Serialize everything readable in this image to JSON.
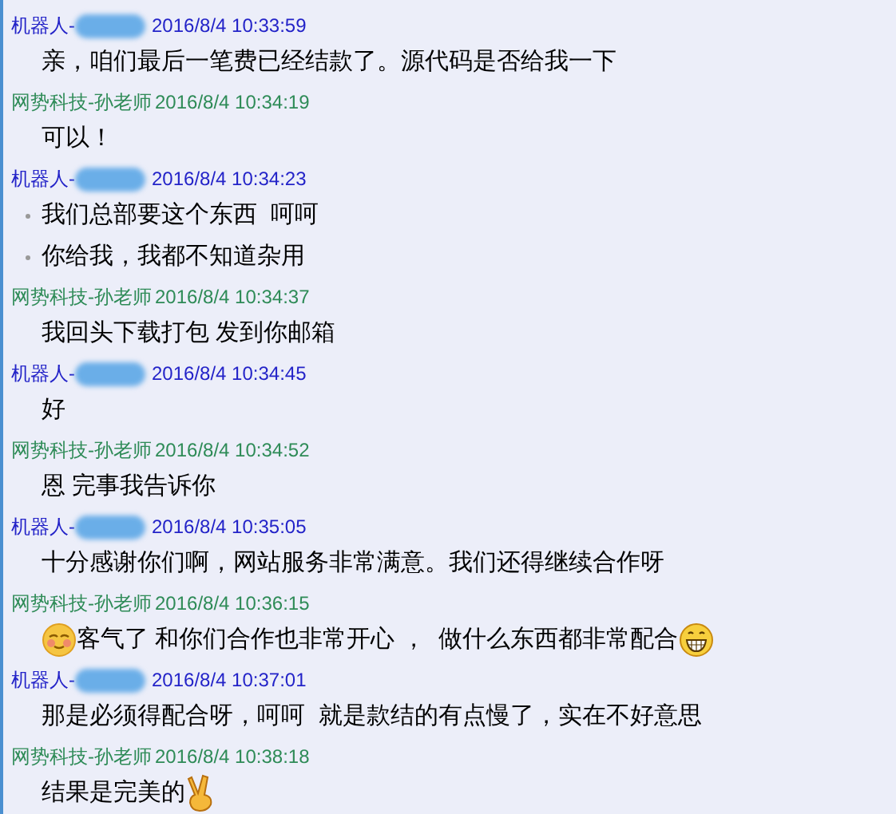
{
  "messages": [
    {
      "sender": "机器人-",
      "kind": "customer",
      "redacted": true,
      "time": "2016/8/4 10:33:59",
      "lines": [
        {
          "bullet": false,
          "parts": [
            {
              "kind": "text",
              "text": "亲，咱们最后一笔费已经结款了。源代码是否给我一下"
            }
          ]
        }
      ]
    },
    {
      "sender": "网势科技-孙老师",
      "kind": "staff",
      "redacted": false,
      "time": "2016/8/4 10:34:19",
      "lines": [
        {
          "bullet": false,
          "parts": [
            {
              "kind": "text",
              "text": "可以！"
            }
          ]
        }
      ]
    },
    {
      "sender": "机器人-",
      "kind": "customer",
      "redacted": true,
      "time": "2016/8/4 10:34:23",
      "lines": [
        {
          "bullet": true,
          "parts": [
            {
              "kind": "text",
              "text": "我们总部要这个东西  呵呵"
            }
          ]
        },
        {
          "bullet": true,
          "parts": [
            {
              "kind": "text",
              "text": "你给我，我都不知道杂用"
            }
          ]
        }
      ]
    },
    {
      "sender": "网势科技-孙老师",
      "kind": "staff",
      "redacted": false,
      "time": "2016/8/4 10:34:37",
      "lines": [
        {
          "bullet": false,
          "parts": [
            {
              "kind": "text",
              "text": "我回头下载打包 发到你邮箱"
            }
          ]
        }
      ]
    },
    {
      "sender": "机器人-",
      "kind": "customer",
      "redacted": true,
      "time": "2016/8/4 10:34:45",
      "lines": [
        {
          "bullet": false,
          "parts": [
            {
              "kind": "text",
              "text": "好"
            }
          ]
        }
      ]
    },
    {
      "sender": "网势科技-孙老师",
      "kind": "staff",
      "redacted": false,
      "time": "2016/8/4 10:34:52",
      "lines": [
        {
          "bullet": false,
          "parts": [
            {
              "kind": "text",
              "text": "恩 完事我告诉你"
            }
          ]
        }
      ]
    },
    {
      "sender": "机器人-",
      "kind": "customer",
      "redacted": true,
      "time": "2016/8/4 10:35:05",
      "lines": [
        {
          "bullet": false,
          "parts": [
            {
              "kind": "text",
              "text": "十分感谢你们啊，网站服务非常满意。我们还得继续合作呀"
            }
          ]
        }
      ]
    },
    {
      "sender": "网势科技-孙老师",
      "kind": "staff",
      "redacted": false,
      "time": "2016/8/4 10:36:15",
      "lines": [
        {
          "bullet": false,
          "parts": [
            {
              "kind": "blush"
            },
            {
              "kind": "text",
              "text": "客气了 和你们合作也非常开心 ，  做什么东西都非常配合"
            },
            {
              "kind": "grin"
            }
          ]
        }
      ]
    },
    {
      "sender": "机器人-",
      "kind": "customer",
      "redacted": true,
      "time": "2016/8/4 10:37:01",
      "lines": [
        {
          "bullet": false,
          "parts": [
            {
              "kind": "text",
              "text": "那是必须得配合呀，呵呵  就是款结的有点慢了，实在不好意思"
            }
          ]
        }
      ]
    },
    {
      "sender": "网势科技-孙老师",
      "kind": "staff",
      "redacted": false,
      "time": "2016/8/4 10:38:18",
      "lines": [
        {
          "bullet": false,
          "parts": [
            {
              "kind": "text",
              "text": "结果是完美的"
            },
            {
              "kind": "victory"
            }
          ]
        }
      ]
    }
  ]
}
